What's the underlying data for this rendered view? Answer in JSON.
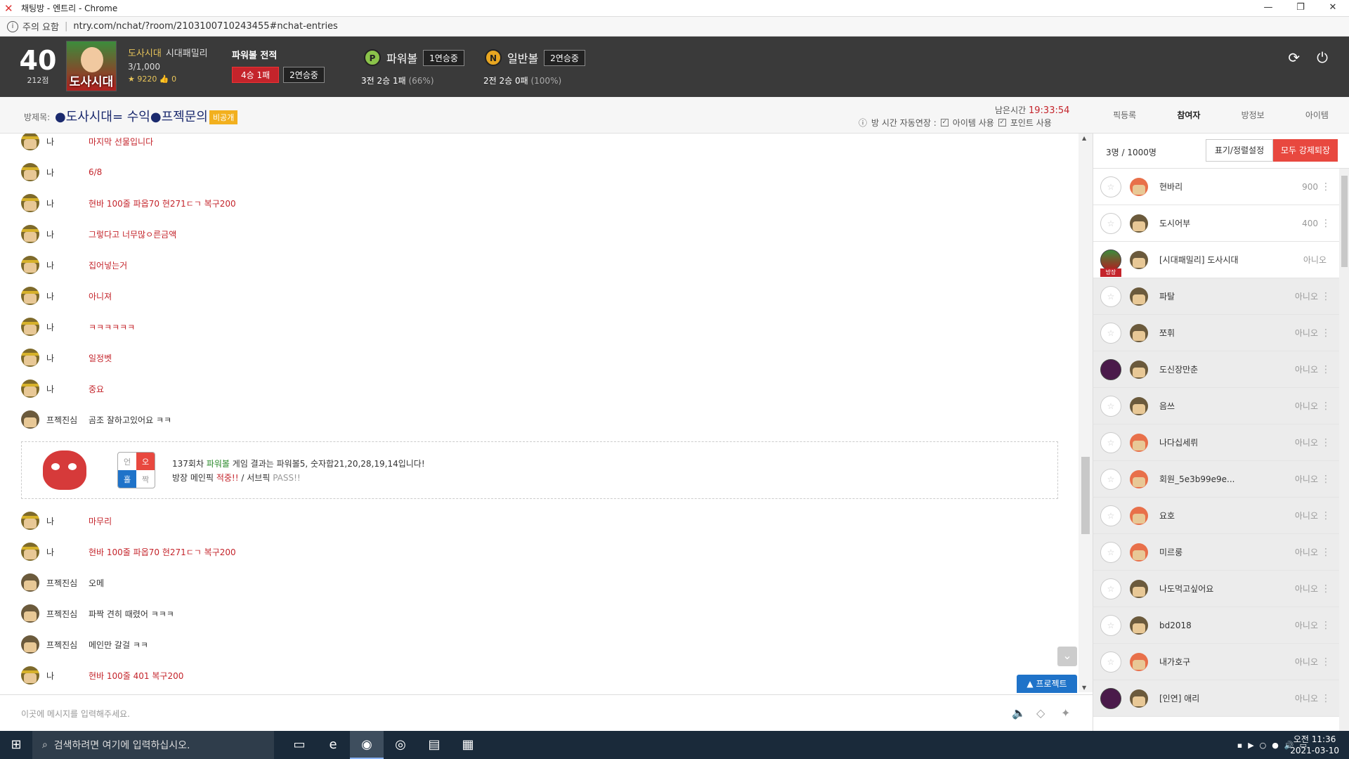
{
  "window": {
    "title": "채팅방 - 엔트리 - Chrome",
    "url_warning": "주의 요함",
    "url": "ntry.com/nchat/?room/2103100710243455#nchat-entries"
  },
  "header": {
    "level": "40",
    "points": "212점",
    "avatar_text": "도사시대",
    "user_name": "도사시대",
    "user_family": "시대패밀리",
    "user_count": "3/1,000",
    "stars": "9220",
    "likes": "0",
    "power_record_title": "파워볼 전적",
    "power_record_badge": "4승 1패",
    "power_record_streak": "2연승중",
    "powerball_label": "파워볼",
    "powerball_streak": "1연승중",
    "powerball_stats": "3전 2승 1패",
    "powerball_pct": "(66%)",
    "normal_label": "일반볼",
    "normal_streak": "2연승중",
    "normal_stats": "2전 2승 0패",
    "normal_pct": "(100%)",
    "ball_p": "P",
    "ball_n": "N"
  },
  "room": {
    "label": "방제목:",
    "title": "●도사시대= 수익●프젝문의",
    "private": "비공개",
    "time_label": "남은시간",
    "time": "19:33:54",
    "opt_auto": "방 시간 자동연장 :",
    "opt_item": "아이템 사용",
    "opt_point": "포인트 사용"
  },
  "tabs": [
    "픽등록",
    "참여자",
    "방정보",
    "아이템"
  ],
  "chat": [
    {
      "who": "나",
      "text": "마지막 선물입니다",
      "me": true
    },
    {
      "who": "나",
      "text": "6/8",
      "me": true
    },
    {
      "who": "나",
      "text": "현바 100줄 파옵70 현271ㄷㄱ 복구200",
      "me": true
    },
    {
      "who": "나",
      "text": "그렇다고 너무많ㅇ른금액",
      "me": true
    },
    {
      "who": "나",
      "text": "집어넣는거",
      "me": true
    },
    {
      "who": "나",
      "text": "아니져",
      "me": true
    },
    {
      "who": "나",
      "text": "ㅋㅋㅋㅋㅋㅋ",
      "me": true
    },
    {
      "who": "나",
      "text": "일정벳",
      "me": true
    },
    {
      "who": "나",
      "text": "중요",
      "me": true
    },
    {
      "who": "프젝진심",
      "text": "곰조 잘하고있어요 ㅋㅋ",
      "me": false
    }
  ],
  "chat2": [
    {
      "who": "나",
      "text": "마무리",
      "me": true
    },
    {
      "who": "나",
      "text": "현바 100줄 파옵70 현271ㄷㄱ 복구200",
      "me": true
    },
    {
      "who": "프젝진심",
      "text": "오메",
      "me": false
    },
    {
      "who": "프젝진심",
      "text": "파짝 견히 때렸어 ㅋㅋㅋ",
      "me": false
    },
    {
      "who": "프젝진심",
      "text": "메인만 갈걸 ㅋㅋ",
      "me": false
    },
    {
      "who": "나",
      "text": "현바 100줄 401 복구200",
      "me": true
    }
  ],
  "system": {
    "grid": [
      "언",
      "오",
      "홀",
      "짝"
    ],
    "line1_pre": "137회차",
    "line1_pw": "파워볼",
    "line1_post": "게임 결과는 파워볼5, 숫자합21,20,28,19,14입니다!",
    "line2_pre": "방장 메인픽",
    "line2_hit": "적중!!",
    "line2_mid": "/ 서브픽",
    "line2_pass": "PASS!!"
  },
  "input": {
    "placeholder": "이곳에 메시지를 입력해주세요.",
    "project_btn": "▲ 프로젝트"
  },
  "panel": {
    "count": "3명 / 1000명",
    "btn_display": "표기/정렬설정",
    "btn_kick": "모두 강제퇴장",
    "host_tag": "방장",
    "members": [
      {
        "name": "현바리",
        "value": "900",
        "new": true,
        "gray": false,
        "ring": "plain"
      },
      {
        "name": "도시어부",
        "value": "400",
        "new": false,
        "gray": false,
        "ring": "plain"
      },
      {
        "name": "[시대패밀리] 도사시대",
        "value": "아니오",
        "new": false,
        "gray": false,
        "ring": "img"
      },
      {
        "name": "파탈",
        "value": "아니오",
        "new": false,
        "gray": true,
        "ring": "plain"
      },
      {
        "name": "쪼휘",
        "value": "아니오",
        "new": false,
        "gray": true,
        "ring": "plain"
      },
      {
        "name": "도신장만춘",
        "value": "아니오",
        "new": false,
        "gray": true,
        "ring": "rad"
      },
      {
        "name": "음쓰",
        "value": "아니오",
        "new": false,
        "gray": true,
        "ring": "plain"
      },
      {
        "name": "나다십세뤼",
        "value": "아니오",
        "new": true,
        "gray": true,
        "ring": "plain"
      },
      {
        "name": "회원_5e3b99e9e...",
        "value": "아니오",
        "new": true,
        "gray": true,
        "ring": "plain"
      },
      {
        "name": "요호",
        "value": "아니오",
        "new": true,
        "gray": true,
        "ring": "plain"
      },
      {
        "name": "미르룽",
        "value": "아니오",
        "new": true,
        "gray": true,
        "ring": "plain"
      },
      {
        "name": "나도먹고싶어요",
        "value": "아니오",
        "new": false,
        "gray": true,
        "ring": "plain"
      },
      {
        "name": "bd2018",
        "value": "아니오",
        "new": false,
        "gray": true,
        "ring": "plain"
      },
      {
        "name": "내가호구",
        "value": "아니오",
        "new": true,
        "gray": true,
        "ring": "plain"
      },
      {
        "name": "[인연] 애리",
        "value": "아니오",
        "new": false,
        "gray": true,
        "ring": "rad"
      }
    ]
  },
  "taskbar": {
    "search": "검색하려면 여기에 입력하십시오.",
    "time": "오전 11:36",
    "date": "2021-03-10"
  }
}
